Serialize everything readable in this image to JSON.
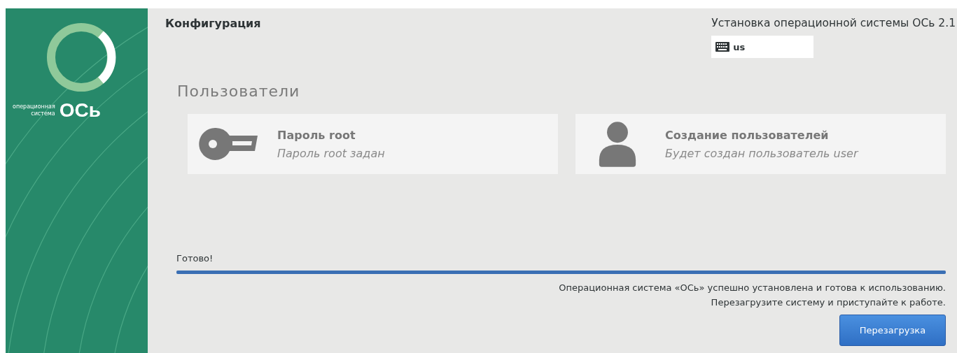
{
  "sidebar": {
    "logo": {
      "line_1": "операционная",
      "line_2": "система",
      "mark": "ОСь"
    }
  },
  "header": {
    "section": "Конфигурация",
    "product": "Установка операционной системы ОСь 2.1",
    "keyboard_layout": "us"
  },
  "category": {
    "title": "Пользователи",
    "spokes": [
      {
        "kind": "key",
        "title": "Пароль root",
        "status": "Пароль root задан"
      },
      {
        "kind": "user",
        "title": "Создание пользователей",
        "status": "Будет создан пользователь user"
      }
    ]
  },
  "progress": {
    "label": "Готово!",
    "level": 1
  },
  "messages": [
    "Операционная система «ОСь» успешно установлена и готова к использованию.",
    "Перезагрузите систему и приступайте к работе."
  ],
  "buttons": [
    "Перезагрузка"
  ]
}
